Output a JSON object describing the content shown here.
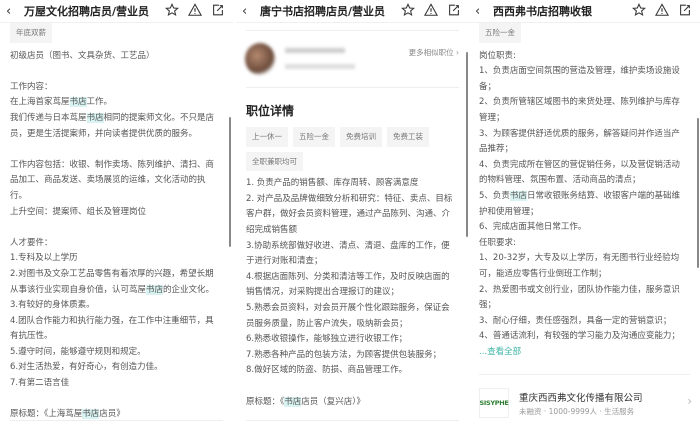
{
  "panels": [
    {
      "title": "万屋文化招聘店员/营业员",
      "tags": [
        "年底双薪"
      ],
      "paragraphs": [
        "初级店员（图书、文具杂货、工艺品）",
        "",
        "工作内容：",
        "在上海首家茑屋书店工作。",
        "我们传递与日本茑屋书店相同的提案师文化。不只是店员，更是生活提案师，并向读者提供优质的服务。",
        "",
        "工作内容包括：收银、制作卖场、陈列维护、清扫、商品加工、商品发送、卖场展览的运维，文化活动的执行。",
        "上升空间：提案师、组长及管理岗位",
        "",
        "人才要件：",
        "1.专科及以上学历",
        "2.对图书及文杂工艺品零售有着浓厚的兴趣，希望长期从事该行业实现自身价值，认可茑屋书店的企业文化。",
        "3.有较好的身体质素。",
        "4.团队合作能力和执行能力强，在工作中注重细节，具有抗压性。",
        "5.遵守时间，能够遵守规则和规定。",
        "6.对生活热爱，有好奇心，有创造力佳。",
        "7.有第二语言佳",
        "",
        "原标题：《上海茑屋书店店员》"
      ]
    },
    {
      "title": "唐宁书店招聘店员/营业员",
      "more_similar": "更多相似职位",
      "section_title": "职位详情",
      "tags": [
        "上一休一",
        "五险一金",
        "免费培训",
        "免费工装",
        "全职兼职均可"
      ],
      "paragraphs": [
        "1. 负责产品的销售额、库存周转、顾客满意度",
        "2. 对产品及品牌做细致分析和研究：特征、卖点、目标客户群，做好会员资料管理，通过产品陈列、沟通、介绍完成销售额",
        "3.协助系统部做好收进、清点、清退、盘库的工作，便于进行对账和清查；",
        "4.根据店面陈列、分类和清洁等工作，及时反映店面的销售情况，对采购提出合理报订的建议；",
        "5.熟悉会员资料，对会员开展个性化跟踪服务，保证会员服务质量，防止客户流失，吸纳新会员；",
        "6.熟悉收银操作，能够独立进行收银工作；",
        "7.熟悉各种产品的包装方法，为顾客提供包装服务；",
        "8.做好区域的防盗、防损、商品管理工作。",
        "",
        "原标题：《书店店员（复兴店）》"
      ]
    },
    {
      "title": "西西弗书店招聘收银",
      "tags": [
        "五险一金"
      ],
      "paragraphs": [
        "岗位职责:",
        "1、负责店面空间氛围的营造及管理，维护卖场设施设备；",
        "2、负责所管辖区域图书的来货处理、陈列维护与库存管理；",
        "3、为顾客提供舒适优质的服务，解答疑问并作适当产品推荐；",
        "4、负责完成所在管区的营促销任务，以及营促销活动的物料管理、氛围布置、活动商品的清点；",
        "5、负责书店日常收银账务结算、收银客户端的基础维护和使用管理；",
        "6、完成店面其他日常工作。",
        "任职要求:",
        "1、20-32岁，大专及以上学历，有无图书行业经验均可，能适应零售行业倒班工作制；",
        "2、热爱图书或文创行业，团队协作能力佳，服务意识强；",
        "3、耐心仔细，责任感强烈，具备一定的营销意识；",
        "4、普通话流利，有较强的学习能力及沟通应变能力；"
      ],
      "view_all": "...查看全部",
      "company": {
        "logo": "SISYPHE",
        "name": "重庆西西弗文化传播有限公司",
        "meta": "未融资 · 1000-9999人 · 生活服务"
      }
    }
  ],
  "icons": {
    "back": "chevron-left-icon",
    "favorite": "star-icon",
    "report": "warning-icon",
    "share": "share-icon"
  },
  "colors": {
    "highlight": "#d8f3f1",
    "link": "#3cb4a4",
    "logo_red": "#c8102e",
    "logo_green": "#2e7d32"
  }
}
